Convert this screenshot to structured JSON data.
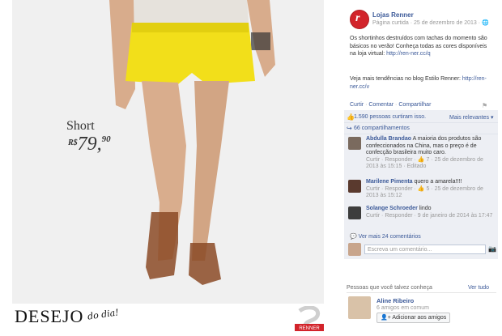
{
  "photo": {
    "product_label": "Short",
    "price_currency": "R$",
    "price_value": "79,",
    "price_cents": "90",
    "desejo_title": "DESEJO",
    "desejo_script": "do dia!",
    "logo_text": "RENNER"
  },
  "post": {
    "page_name": "Lojas Renner",
    "page_meta": "Página curtida · 25 de dezembro de 2013 · ",
    "avatar_letter": "r",
    "text": "Os shortinhos destruídos com tachas do momento são básicos no verão! Conheça todas as cores disponíveis na loja virtual: ",
    "text_link": "http://ren-ner.cc/q",
    "text2": "Veja mais tendências no blog Estilo Renner: ",
    "text2_link": "http://ren-ner.cc/v"
  },
  "actions": {
    "like": "Curtir",
    "comment": "Comentar",
    "share": "Compartilhar"
  },
  "ufi": {
    "likes_text": "1.590 pessoas curtiram isso.",
    "relevance": "Mais relevantes ▾",
    "shares_text": "66 compartilhamentos",
    "more_comments": "Ver mais 24 comentários",
    "composer_placeholder": "Escreva um comentário..."
  },
  "comments": [
    {
      "name": "Abdulla Brandao",
      "text": " A maioria dos produtos são confeccionados na China, mas o preço é de confecção brasileira muito caro.",
      "meta_pre": "Curtir · Responder · ",
      "meta_post": " 7 · 25 de dezembro de 2013 às 15:15 · Editado"
    },
    {
      "name": "Marilene Pimenta",
      "text": " quero a amarela!!!!",
      "meta_pre": "Curtir · Responder · ",
      "meta_post": " 5 · 25 de dezembro de 2013 às 15:12"
    },
    {
      "name": "Solange Schroeder",
      "text": " lindo",
      "meta_pre": "Curtir · Responder · ",
      "meta_post": "9 de janeiro de 2014 às 17:47"
    }
  ],
  "pymk": {
    "title": "Pessoas que você talvez conheça",
    "see_all": "Ver tudo",
    "name": "Aline Ribeiro",
    "mutual": "6 amigos em comum",
    "add_button": "Adicionar aos amigos"
  },
  "colors": {
    "facebook_blue": "#3b5998",
    "renner_red": "#d2232a",
    "shorts_yellow": "#f2df1a"
  }
}
